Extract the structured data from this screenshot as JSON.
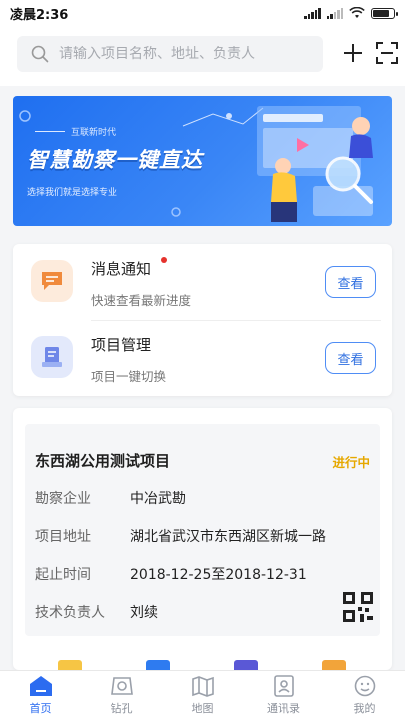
{
  "status_bar": {
    "time": "凌晨2:36"
  },
  "search": {
    "placeholder": "请输入项目名称、地址、负责人"
  },
  "banner": {
    "subtitle": "互联新时代",
    "title": "智慧勘察一键直达",
    "slogan": "选择我们就是选择专业"
  },
  "entries": [
    {
      "title": "消息通知",
      "desc": "快速查看最新进度",
      "button": "查看",
      "unread": true,
      "icon": "message-icon"
    },
    {
      "title": "项目管理",
      "desc": "项目一键切换",
      "button": "查看",
      "icon": "project-icon"
    }
  ],
  "project": {
    "name": "东西湖公用测试项目",
    "status": "进行中",
    "rows": [
      {
        "label": "勘察企业",
        "value": "中冶武勘"
      },
      {
        "label": "项目地址",
        "value": "湖北省武汉市东西湖区新城一路"
      },
      {
        "label": "起止时间",
        "value": "2018-12-25至2018-12-31"
      },
      {
        "label": "技术负责人",
        "value": "刘续"
      }
    ]
  },
  "tabs": [
    {
      "label": "首页",
      "icon": "home-icon",
      "active": true
    },
    {
      "label": "钻孔",
      "icon": "drill-icon"
    },
    {
      "label": "地图",
      "icon": "map-icon"
    },
    {
      "label": "通讯录",
      "icon": "contacts-icon"
    },
    {
      "label": "我的",
      "icon": "profile-icon"
    }
  ],
  "colors": {
    "accent": "#2c6cf0",
    "status_running": "#e6a800",
    "banner": "#2f7cf3"
  }
}
